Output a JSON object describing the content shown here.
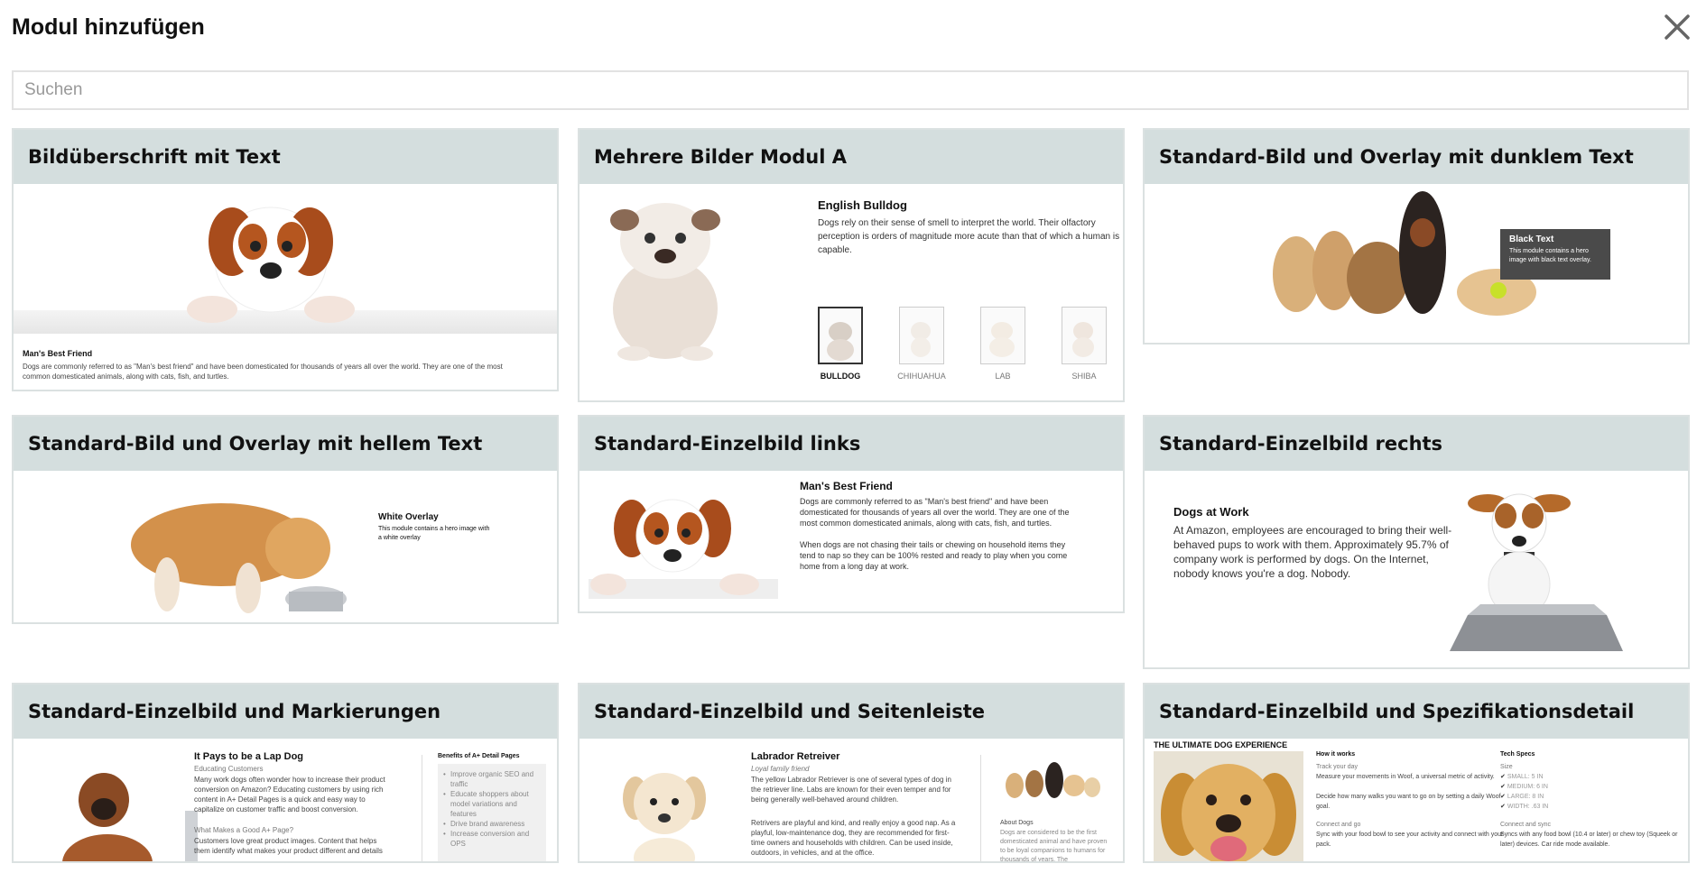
{
  "dialog": {
    "title": "Modul hinzufügen",
    "close_icon": "close-icon"
  },
  "search": {
    "placeholder": "Suchen",
    "value": ""
  },
  "modules": [
    {
      "title": "Bildüberschrift mit Text",
      "caption_heading": "Man's Best Friend",
      "caption_text": "Dogs are commonly referred to as \"Man's best friend\" and have been domesticated for thousands of years all over the world. They are one of the most common domesticated animals, along with cats, fish, and turtles."
    },
    {
      "title": "Mehrere Bilder Modul A",
      "heading": "English Bulldog",
      "text": "Dogs rely on their sense of smell to interpret the world. Their olfactory perception is orders of magnitude more acute than that of which a human is capable.",
      "thumbs": [
        "BULLDOG",
        "CHIHUAHUA",
        "LAB",
        "SHIBA"
      ]
    },
    {
      "title": "Standard-Bild und Overlay mit dunklem Text",
      "overlay_heading": "Black Text",
      "overlay_text": "This module contains a hero image with black text overlay."
    },
    {
      "title": "Standard-Bild und Overlay mit hellem Text",
      "overlay_heading": "White Overlay",
      "overlay_text": "This module contains a hero image with a white overlay"
    },
    {
      "title": "Standard-Einzelbild links",
      "heading": "Man's Best Friend",
      "para1": "Dogs are commonly referred to as \"Man's best friend\" and have been domesticated for thousands of years all over the world. They are one of the most common domesticated animals, along with cats, fish, and turtles.",
      "para2": "When dogs are not chasing their tails or chewing on household items they tend to nap so they can be 100% rested and ready to play when you come home from a long day at work."
    },
    {
      "title": "Standard-Einzelbild rechts",
      "heading": "Dogs at Work",
      "text": "At Amazon, employees are encouraged to bring their well-behaved pups to work with them. Approximately 95.7% of company work is performed by dogs. On the Internet, nobody knows you're a dog. Nobody."
    },
    {
      "title": "Standard-Einzelbild und Markierungen",
      "heading": "It Pays to be a Lap Dog",
      "subheading": "Educating Customers",
      "text": "Many work dogs often wonder how to increase their product conversion on Amazon? Educating customers by using rich content in A+ Detail Pages is a quick and easy way to capitalize on customer traffic and boost conversion.",
      "heading2": "What Makes a Good A+ Page?",
      "text2": "Customers love great product images. Content that helps them identify what makes your product different and details",
      "side_title": "Benefits of A+ Detail Pages",
      "bullets": [
        "Improve organic SEO and traffic",
        "Educate shoppers about model variations and features",
        "Drive brand awareness",
        "Increase conversion and OPS"
      ]
    },
    {
      "title": "Standard-Einzelbild und Seitenleiste",
      "heading": "Labrador Retreiver",
      "subheading": "Loyal family friend",
      "text": "The yellow Labrador Retriever is one of several types of dog in the retriever line. Labs are known for their even temper and for being generally well-behaved around children.",
      "text2": "Retrivers are playful and kind, and really enjoy a good nap. As a playful, low-maintenance dog, they are recommended for first-time owners and households with children. Can be used inside, outdoors, in vehicles, and at the office.",
      "side_heading": "About Dogs",
      "side_text": "Dogs are considered to be the first domesticated animal and have proven to be loyal companions to humans for thousands of years. The"
    },
    {
      "title": "Standard-Einzelbild und Spezifikationsdetail",
      "banner": "THE ULTIMATE DOG EXPERIENCE",
      "how_title": "How it works",
      "track_title": "Track your day",
      "track_text": "Measure your movements in Woof, a universal metric of activity.",
      "track_text2": "Decide how many walks you want to go on by setting a daily Woof goal.",
      "connect_title": "Connect and go",
      "connect_text": "Sync with your food bowl to see your activity and connect with your pack.",
      "specs_title": "Tech Specs",
      "size_title": "Size",
      "sizes": [
        "SMALL: 5 IN",
        "MEDIUM: 6 IN",
        "LARGE: 8 IN",
        "WIDTH: .63 IN"
      ],
      "sync_title": "Connect and sync",
      "sync_text": "Syncs with any food bowl (10.4 or later) or chew toy (Squeek or later) devices. Car ride mode available."
    }
  ]
}
